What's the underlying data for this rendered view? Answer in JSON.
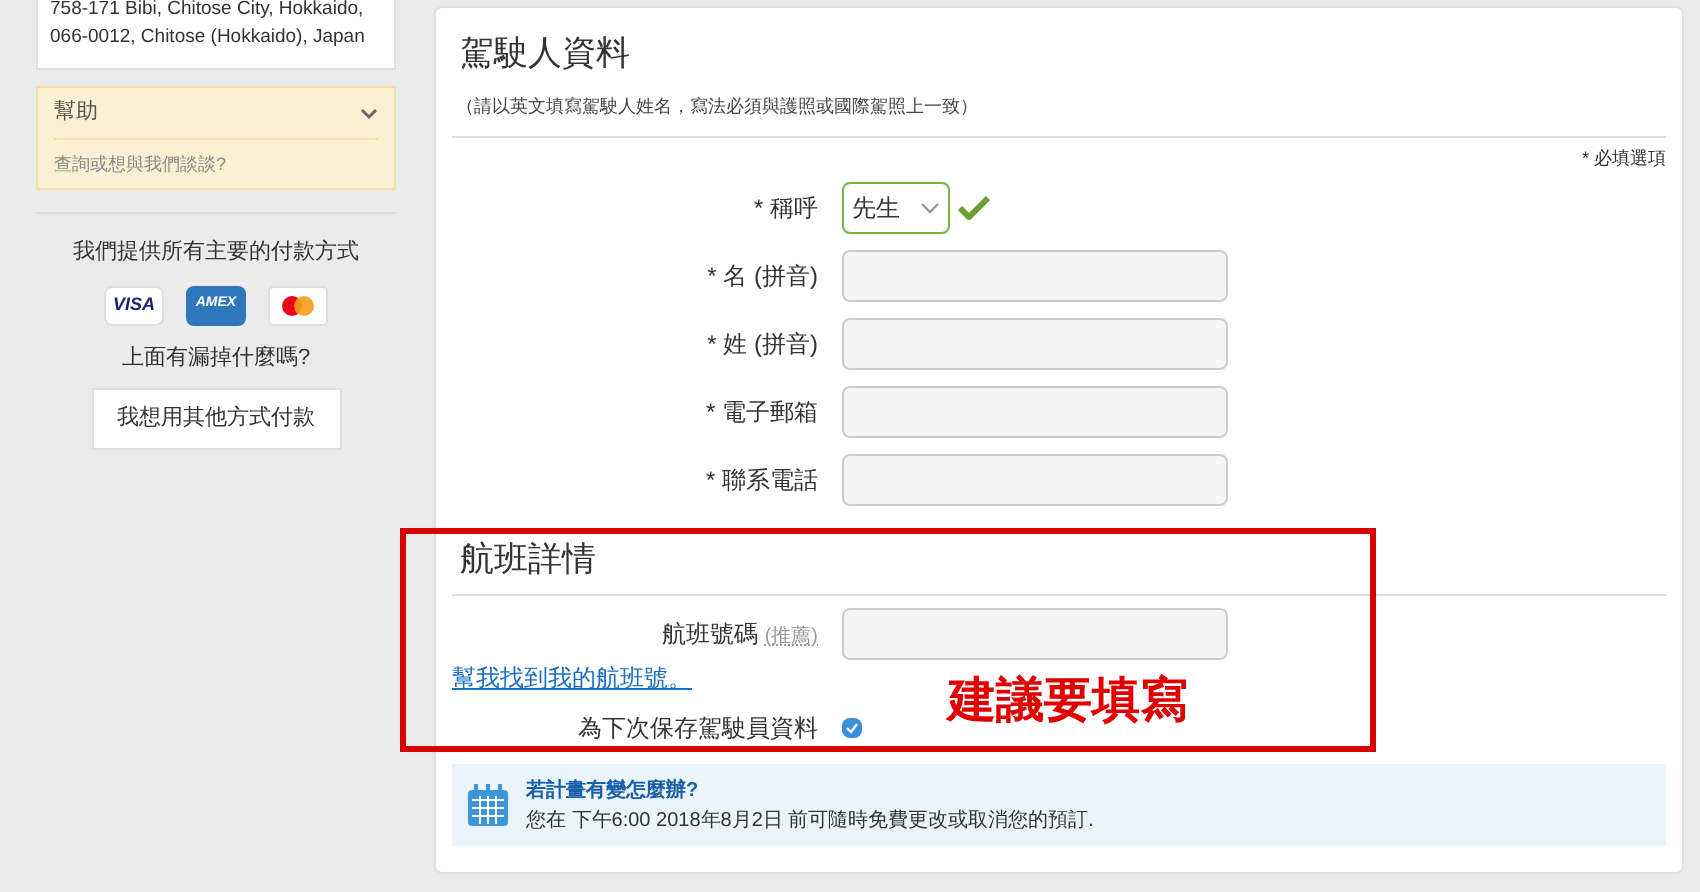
{
  "sidebar": {
    "address_lines": [
      "758-171 Bibi, Chitose City, Hokkaido,",
      "066-0012, Chitose (Hokkaido), Japan"
    ],
    "help": {
      "title": "幫助",
      "expanded": true,
      "link": "查詢或想與我們談談?"
    },
    "payment": {
      "title": "我們提供所有主要的付款方式",
      "cards": [
        {
          "kind": "visa",
          "label": "VISA"
        },
        {
          "kind": "amex",
          "label": "AMEX"
        },
        {
          "kind": "mastercard"
        }
      ],
      "question": "上面有漏掉什麼嗎?",
      "button": "我想用其他方式付款"
    }
  },
  "driver": {
    "title": "駕駛人資料",
    "hint": "（請以英文填寫駕駛人姓名，寫法必須與護照或國際駕照上一致）",
    "required_note": "* 必填選項",
    "fields": [
      {
        "kind": "select",
        "label": "* 稱呼",
        "value": "先生",
        "valid": true
      },
      {
        "kind": "text",
        "label": "* 名 (拼音)"
      },
      {
        "kind": "text",
        "label": "* 姓 (拼音)"
      },
      {
        "kind": "text",
        "label": "* 電子郵箱"
      },
      {
        "kind": "text",
        "label": "* 聯系電話"
      }
    ]
  },
  "flight": {
    "title": "航班詳情",
    "field_label": "航班號碼",
    "field_note": "(推薦)",
    "help_link": "幫我找到我的航班號。",
    "save_label": "為下次保存駕駛員資料",
    "save_checked": true
  },
  "annotation": {
    "text": "建議要填寫"
  },
  "info": {
    "title": "若計畫有變怎麼辦?",
    "text": "您在 下午6:00 2018年8月2日 前可隨時免費更改或取消您的預訂."
  }
}
